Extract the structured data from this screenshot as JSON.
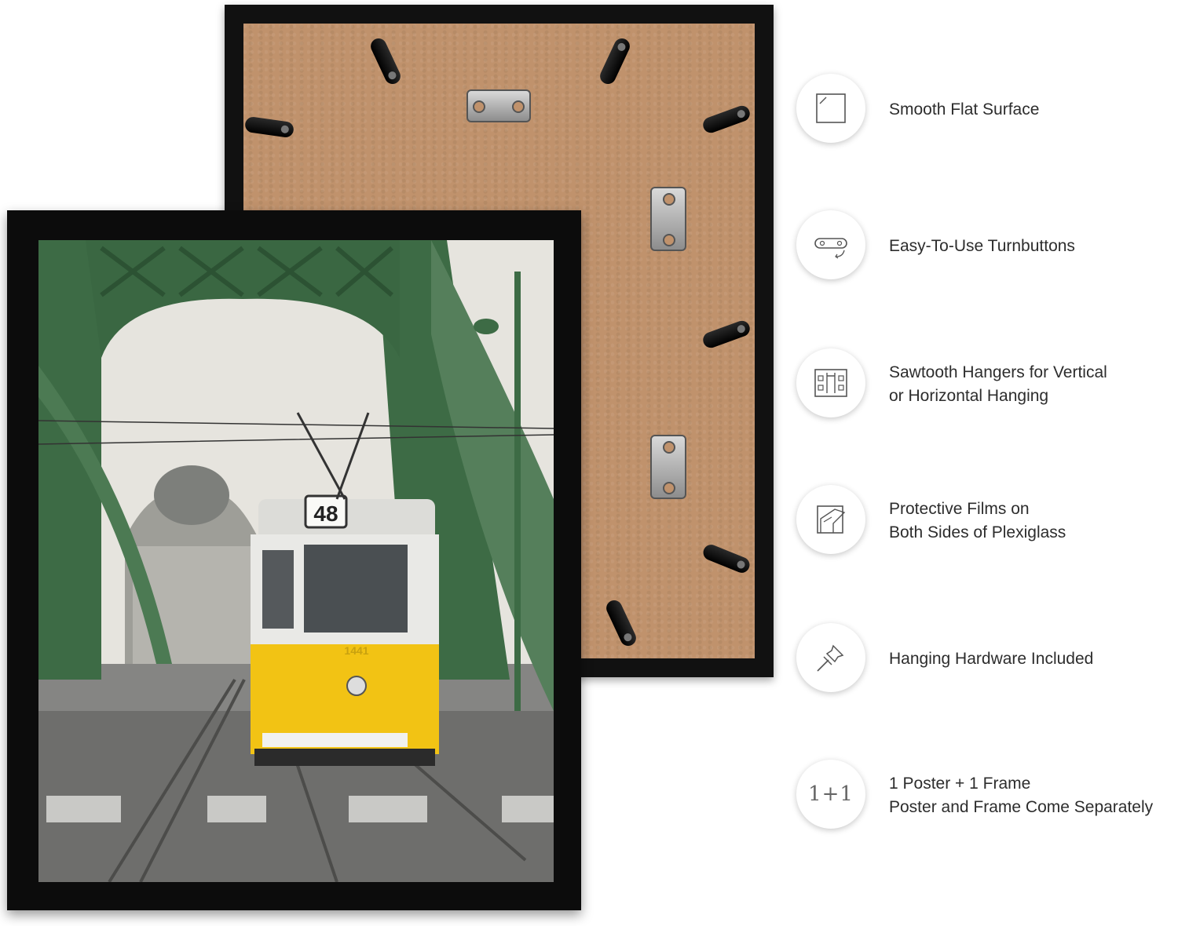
{
  "poster": {
    "tram_route_number": "48",
    "tram_fleet_number": "1441"
  },
  "features": [
    {
      "icon": "smooth-surface-icon",
      "lines": [
        "Smooth Flat Surface"
      ]
    },
    {
      "icon": "turnbutton-icon",
      "lines": [
        "Easy-To-Use Turnbuttons"
      ]
    },
    {
      "icon": "sawtooth-hanger-icon",
      "lines": [
        "Sawtooth Hangers for Vertical",
        "or Horizontal Hanging"
      ]
    },
    {
      "icon": "protective-film-icon",
      "lines": [
        "Protective Films on",
        "Both Sides of Plexiglass"
      ]
    },
    {
      "icon": "push-pin-icon",
      "lines": [
        "Hanging Hardware Included"
      ]
    },
    {
      "icon": "one-plus-one-icon",
      "glyph": "1+1",
      "lines": [
        "1 Poster + 1 Frame",
        "Poster and Frame Come Separately"
      ]
    }
  ],
  "colors": {
    "frame": "#0c0c0c",
    "backing": "#c0926c",
    "bridge_green": "#3d6b45",
    "tram_yellow": "#f2c314",
    "text": "#2d2d2d"
  }
}
